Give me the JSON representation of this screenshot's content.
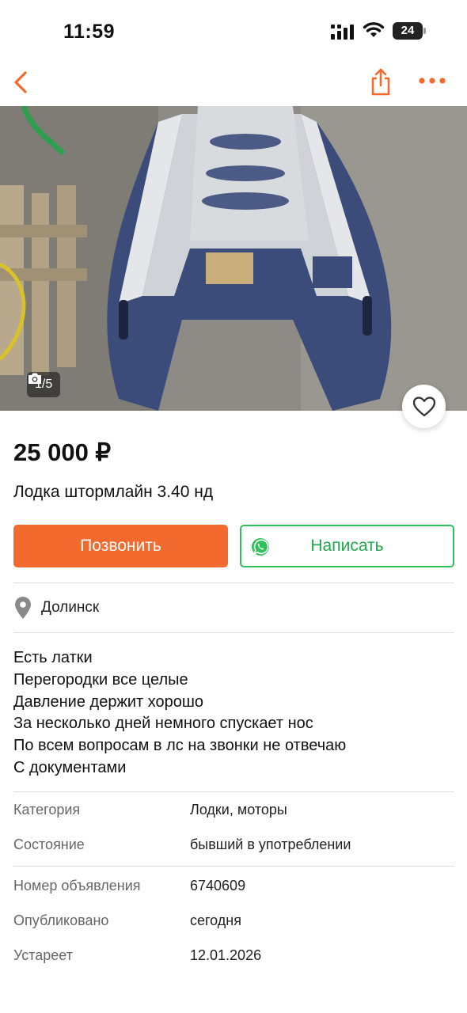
{
  "status_bar": {
    "time": "11:59",
    "battery": "24"
  },
  "nav": {
    "back_icon": "chevron-left-icon",
    "share_icon": "share-icon",
    "more_icon": "more-dots-icon"
  },
  "gallery": {
    "counter": "1/5"
  },
  "listing": {
    "price": "25 000 ₽",
    "title": "Лодка штормлайн 3.40 нд"
  },
  "actions": {
    "call_label": "Позвонить",
    "message_label": "Написать"
  },
  "location": "Долинск",
  "description": [
    "Есть латки",
    "Перегородки все целые",
    "Давление держит хорошо",
    "За несколько дней немного спускает нос",
    "По всем вопросам в лс на звонки не отвечаю",
    "С документами"
  ],
  "details": [
    {
      "key": "Категория",
      "value": "Лодки, моторы"
    },
    {
      "key": "Состояние",
      "value": "бывший в употреблении"
    },
    {
      "key": "Номер объявления",
      "value": "6740609"
    },
    {
      "key": "Опубликовано",
      "value": "сегодня"
    },
    {
      "key": "Устареет",
      "value": "12.01.2026"
    }
  ],
  "colors": {
    "accent": "#f26a2e",
    "whatsapp": "#2ec05a"
  }
}
